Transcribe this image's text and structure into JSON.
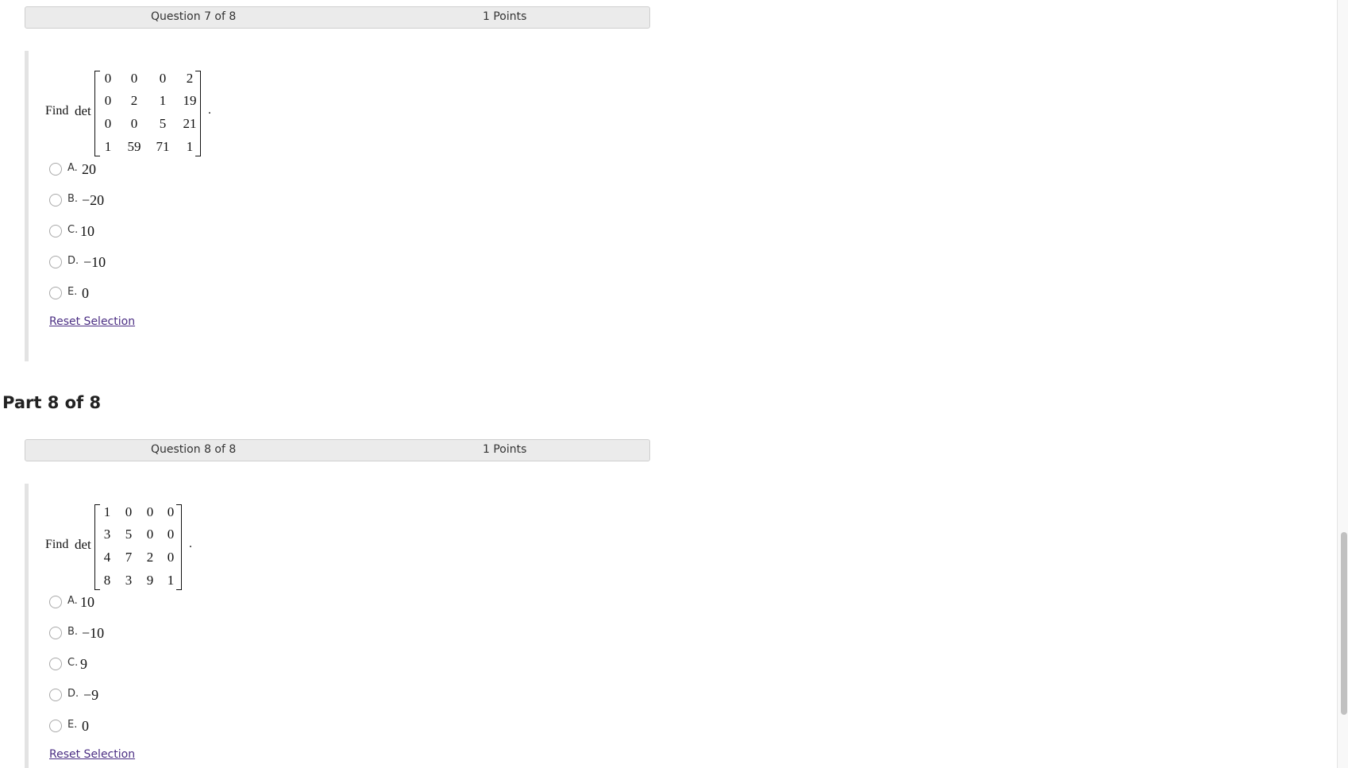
{
  "questions": [
    {
      "header": {
        "question": "Question 7 of 8",
        "points": "1 Points"
      },
      "prompt": {
        "find": "Find",
        "det": "det",
        "period": "."
      },
      "matrix": [
        [
          "0",
          "0",
          "0",
          "2"
        ],
        [
          "0",
          "2",
          "1",
          "19"
        ],
        [
          "0",
          "0",
          "5",
          "21"
        ],
        [
          "1",
          "59",
          "71",
          "1"
        ]
      ],
      "options": [
        {
          "letter": "A.",
          "value": "20"
        },
        {
          "letter": "B.",
          "value": "−20"
        },
        {
          "letter": "C.",
          "value": "10"
        },
        {
          "letter": "D.",
          "value": "−10"
        },
        {
          "letter": "E.",
          "value": "0"
        }
      ],
      "reset_label": "Reset Selection"
    },
    {
      "part_title": "Part 8 of 8",
      "header": {
        "question": "Question 8 of 8",
        "points": "1 Points"
      },
      "prompt": {
        "find": "Find",
        "det": "det",
        "period": "."
      },
      "matrix": [
        [
          "1",
          "0",
          "0",
          "0"
        ],
        [
          "3",
          "5",
          "0",
          "0"
        ],
        [
          "4",
          "7",
          "2",
          "0"
        ],
        [
          "8",
          "3",
          "9",
          "1"
        ]
      ],
      "options": [
        {
          "letter": "A.",
          "value": "10"
        },
        {
          "letter": "B.",
          "value": "−10"
        },
        {
          "letter": "C.",
          "value": "9"
        },
        {
          "letter": "D.",
          "value": "−9"
        },
        {
          "letter": "E.",
          "value": "0"
        }
      ],
      "reset_label": "Reset Selection"
    }
  ],
  "colors": {
    "link": "#4b2e83",
    "header_bg": "#ebebeb",
    "block_border": "#e3e3e3"
  }
}
